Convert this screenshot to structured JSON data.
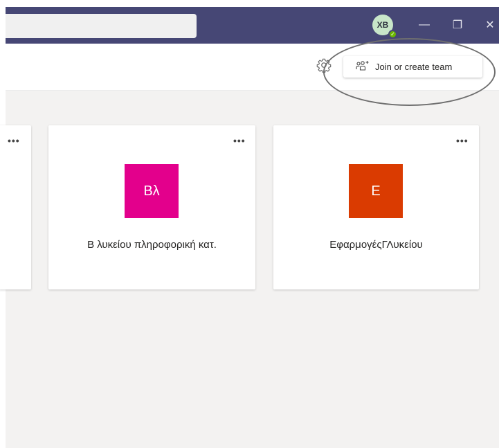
{
  "titlebar": {
    "search_placeholder": "",
    "avatar_initials": "XB",
    "presence_status": "available",
    "minimize_glyph": "—",
    "maximize_glyph": "❐",
    "close_glyph": "✕"
  },
  "toolbar": {
    "join_label": "Join or create team",
    "join_icon": "people-add-icon",
    "settings_icon": "gear-icon"
  },
  "teams": [
    {
      "more_glyph": "•••"
    },
    {
      "more_glyph": "•••",
      "initials": "Βλ",
      "name": "Β λυκείου πληροφορική κατ.",
      "color": "#e3008c"
    },
    {
      "more_glyph": "•••",
      "initials": "Ε",
      "name": "ΕφαρμογέςΓΛυκείου",
      "color": "#da3b01"
    }
  ],
  "colors": {
    "titlebar": "#464775",
    "background": "#f3f2f1",
    "annotation": "#6f6f6f"
  }
}
